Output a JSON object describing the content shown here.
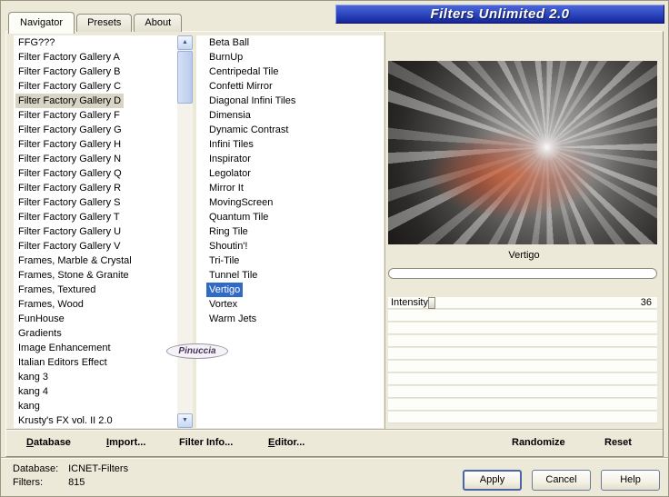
{
  "window": {
    "title": "Filters Unlimited 2.0"
  },
  "tabs": [
    {
      "label": "Navigator"
    },
    {
      "label": "Presets"
    },
    {
      "label": "About"
    }
  ],
  "active_tab_index": 0,
  "categories": {
    "selected_index": 4,
    "items": [
      "FFG???",
      "Filter Factory Gallery A",
      "Filter Factory Gallery B",
      "Filter Factory Gallery C",
      "Filter Factory Gallery D",
      "Filter Factory Gallery F",
      "Filter Factory Gallery G",
      "Filter Factory Gallery H",
      "Filter Factory Gallery N",
      "Filter Factory Gallery Q",
      "Filter Factory Gallery R",
      "Filter Factory Gallery S",
      "Filter Factory Gallery T",
      "Filter Factory Gallery U",
      "Filter Factory Gallery V",
      "Frames, Marble & Crystal",
      "Frames, Stone & Granite",
      "Frames, Textured",
      "Frames, Wood",
      "FunHouse",
      "Gradients",
      "Image Enhancement",
      "Italian Editors Effect",
      "kang 3",
      "kang 4",
      "kang",
      "Krusty's FX vol. II 2.0"
    ]
  },
  "filters_list": {
    "selected_index": 17,
    "items": [
      "Beta Ball",
      "BurnUp",
      "Centripedal Tile",
      "Confetti Mirror",
      "Diagonal Infini Tiles",
      "Dimensia",
      "Dynamic Contrast",
      "Infini Tiles",
      "Inspirator",
      "Legolator",
      "Mirror It",
      "MovingScreen",
      "Quantum Tile",
      "Ring Tile",
      "Shoutin'!",
      "Tri-Tile",
      "Tunnel Tile",
      "Vertigo",
      "Vortex",
      "Warm Jets"
    ]
  },
  "watermark": "Pinuccia",
  "preview": {
    "selected_filter": "Vertigo"
  },
  "params": {
    "sliders": [
      {
        "label": "Intensity",
        "value": "36",
        "thumb_percent": 15
      }
    ],
    "empty_rows": 9
  },
  "toolbar": {
    "database": "Database",
    "import": "Import...",
    "filter_info": "Filter Info...",
    "editor": "Editor...",
    "randomize": "Randomize",
    "reset": "Reset"
  },
  "statusbar": {
    "database_label": "Database:",
    "database_value": "ICNET-Filters",
    "filters_label": "Filters:",
    "filters_value": "815"
  },
  "buttons": {
    "apply": "Apply",
    "cancel": "Cancel",
    "help": "Help"
  },
  "colors": {
    "window_bg": "#ece9d8",
    "titlebar_blue": "#2a44bc",
    "selection_active": "#316ac5",
    "selection_inactive": "#d9d5c4"
  }
}
